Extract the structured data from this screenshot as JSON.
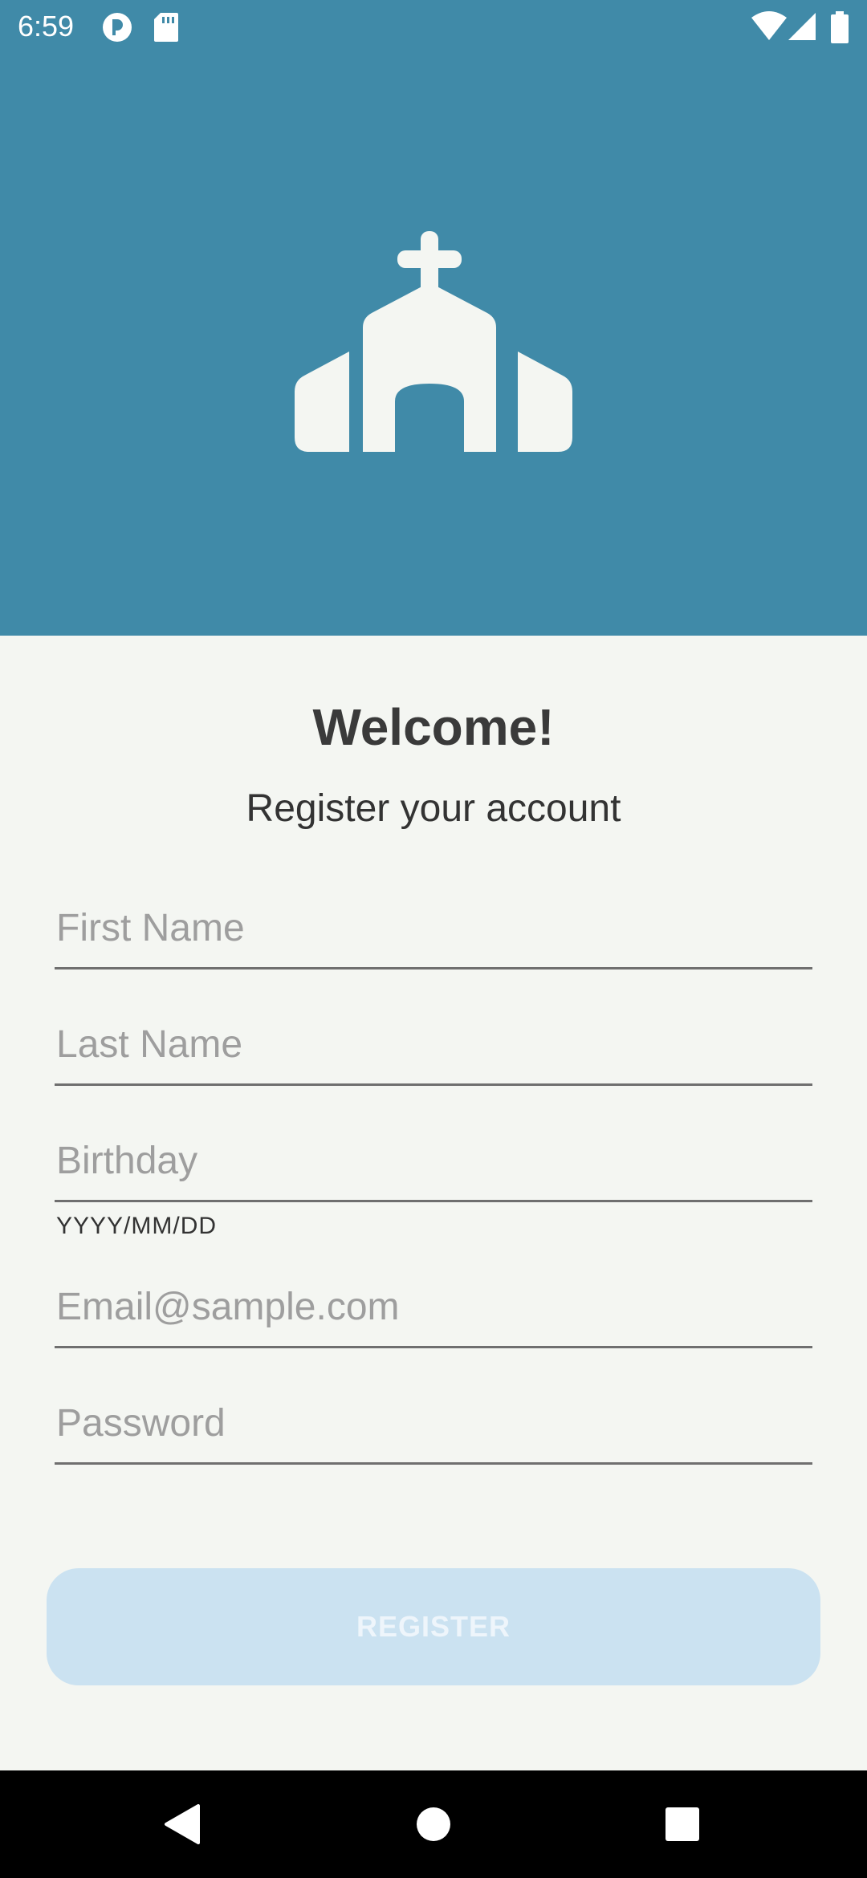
{
  "status_bar": {
    "time": "6:59",
    "icons": [
      "circle-app-icon",
      "sd-card-icon",
      "wifi-icon",
      "signal-icon",
      "battery-icon"
    ]
  },
  "header": {
    "logo_icon": "church-icon",
    "background_color": "#408aa8"
  },
  "form": {
    "title": "Welcome!",
    "subtitle": "Register your account",
    "first_name": {
      "value": "",
      "placeholder": "First Name"
    },
    "last_name": {
      "value": "",
      "placeholder": "Last Name"
    },
    "birthday": {
      "value": "",
      "placeholder": "Birthday",
      "helper": "YYYY/MM/DD"
    },
    "email": {
      "value": "",
      "placeholder": "Email@sample.com"
    },
    "password": {
      "value": "",
      "placeholder": "Password"
    },
    "register_label": "REGISTER",
    "register_enabled": false
  },
  "nav_bar": {
    "buttons": [
      "back-icon",
      "home-icon",
      "recents-icon"
    ]
  }
}
